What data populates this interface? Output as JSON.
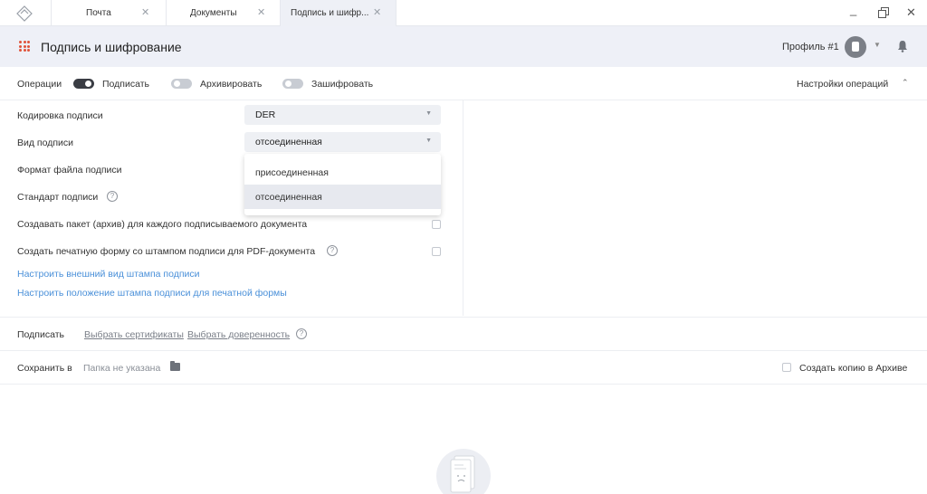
{
  "tabs": [
    {
      "label": "Почта",
      "active": false
    },
    {
      "label": "Документы",
      "active": false
    },
    {
      "label": "Подпись и шифр...",
      "active": true
    }
  ],
  "header": {
    "title": "Подпись и шифрование",
    "profile": "Профиль #1"
  },
  "operations": {
    "label": "Операции",
    "sign": "Подписать",
    "archive": "Архивировать",
    "encrypt": "Зашифровать",
    "sign_on": true,
    "archive_on": false,
    "encrypt_on": false,
    "settings": "Настройки операций"
  },
  "form": {
    "encoding_label": "Кодировка подписи",
    "encoding_value": "DER",
    "type_label": "Вид подписи",
    "type_value": "отсоединенная",
    "file_format_label": "Формат файла подписи",
    "standard_label": "Стандарт подписи",
    "package_label": "Создавать пакет (архив) для каждого подписываемого документа",
    "package_checked": false,
    "print_form_label": "Создать печатную форму со штампом подписи для PDF-документа",
    "print_form_checked": false,
    "stamp_look_link": "Настроить внешний вид штампа подписи",
    "stamp_position_link": "Настроить положение штампа подписи для печатной формы"
  },
  "dropdown": {
    "options": [
      "присоединенная",
      "отсоединенная"
    ],
    "selected": "отсоединенная"
  },
  "sign_row": {
    "label": "Подписать",
    "certificates": "Выбрать сертификаты",
    "power_of_attorney": "Выбрать доверенность"
  },
  "save_row": {
    "label": "Сохранить в",
    "folder": "Папка не указана",
    "archive_copy": "Создать копию в Архиве",
    "archive_copy_checked": false
  },
  "window_controls": [
    "minimize-icon",
    "restore-icon",
    "close-icon"
  ],
  "colors": {
    "accent": "#e0533a",
    "link": "#4a90d9",
    "toggle_on": "#3a3d44"
  }
}
